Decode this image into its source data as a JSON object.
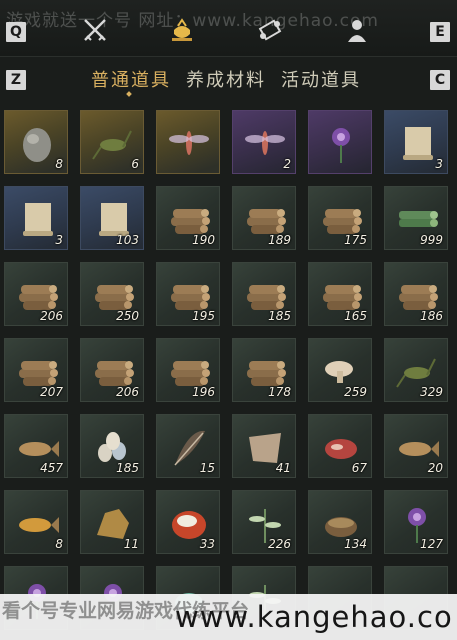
{
  "watermark_top": "游戏就送一个号  网址：www.kangehao.com",
  "keys": {
    "q": "Q",
    "e": "E",
    "z": "Z",
    "c": "C"
  },
  "top_icons": [
    "crossed-swords-icon",
    "cauldron-icon",
    "scroll-icon",
    "character-icon"
  ],
  "tabs": [
    {
      "label": "普通道具",
      "active": true
    },
    {
      "label": "养成材料",
      "active": false
    },
    {
      "label": "活动道具",
      "active": false
    }
  ],
  "items": [
    {
      "name": "stone-item",
      "count": "8",
      "rarity": "gold"
    },
    {
      "name": "cricket-item",
      "count": "6",
      "rarity": "gold"
    },
    {
      "name": "firefly-item",
      "count": "",
      "rarity": "gold"
    },
    {
      "name": "dragonfly-item",
      "count": "2",
      "rarity": "purple"
    },
    {
      "name": "purple-flower-item",
      "count": "",
      "rarity": "purple"
    },
    {
      "name": "scroll-item",
      "count": "3",
      "rarity": "blue"
    },
    {
      "name": "scroll-item",
      "count": "3",
      "rarity": "blue"
    },
    {
      "name": "scroll-item",
      "count": "103",
      "rarity": "blue"
    },
    {
      "name": "log-bundle-item",
      "count": "190",
      "rarity": "green"
    },
    {
      "name": "log-bundle-item",
      "count": "189",
      "rarity": "green"
    },
    {
      "name": "log-bundle-item",
      "count": "175",
      "rarity": "green"
    },
    {
      "name": "bamboo-bundle-item",
      "count": "999",
      "rarity": "green"
    },
    {
      "name": "log-bundle-item",
      "count": "206",
      "rarity": "green"
    },
    {
      "name": "log-bundle-item",
      "count": "250",
      "rarity": "green"
    },
    {
      "name": "log-bundle-item",
      "count": "195",
      "rarity": "green"
    },
    {
      "name": "log-bundle-item",
      "count": "185",
      "rarity": "green"
    },
    {
      "name": "log-bundle-item",
      "count": "165",
      "rarity": "green"
    },
    {
      "name": "log-bundle-item",
      "count": "186",
      "rarity": "green"
    },
    {
      "name": "log-bundle-item",
      "count": "207",
      "rarity": "green"
    },
    {
      "name": "log-bundle-item",
      "count": "206",
      "rarity": "green"
    },
    {
      "name": "log-bundle-item",
      "count": "196",
      "rarity": "green"
    },
    {
      "name": "log-bundle-item",
      "count": "178",
      "rarity": "green"
    },
    {
      "name": "mushroom-item",
      "count": "259",
      "rarity": "green"
    },
    {
      "name": "locust-item",
      "count": "329",
      "rarity": "green"
    },
    {
      "name": "fish-item",
      "count": "457",
      "rarity": "green"
    },
    {
      "name": "eggs-item",
      "count": "185",
      "rarity": "green"
    },
    {
      "name": "feathers-item",
      "count": "15",
      "rarity": "green"
    },
    {
      "name": "hide-item",
      "count": "41",
      "rarity": "green"
    },
    {
      "name": "meat-item",
      "count": "67",
      "rarity": "green"
    },
    {
      "name": "carp-item",
      "count": "20",
      "rarity": "green"
    },
    {
      "name": "goldfish-item",
      "count": "8",
      "rarity": "green"
    },
    {
      "name": "ore-item",
      "count": "11",
      "rarity": "green"
    },
    {
      "name": "amber-item",
      "count": "33",
      "rarity": "green"
    },
    {
      "name": "herb-item",
      "count": "226",
      "rarity": "green"
    },
    {
      "name": "mortar-item",
      "count": "134",
      "rarity": "green"
    },
    {
      "name": "purple-flower-item",
      "count": "127",
      "rarity": "green"
    },
    {
      "name": "lavender-item",
      "count": "",
      "rarity": "green"
    },
    {
      "name": "lavender-item",
      "count": "",
      "rarity": "green"
    },
    {
      "name": "jade-item",
      "count": "",
      "rarity": "green"
    },
    {
      "name": "herb-item",
      "count": "",
      "rarity": "green"
    },
    {
      "name": "blank-item",
      "count": "",
      "rarity": "green"
    },
    {
      "name": "blank-item",
      "count": "",
      "rarity": "green"
    }
  ],
  "bottom_banner": {
    "left_text": "看个号专业网易游戏代练平台",
    "url": "www.kangehao.co"
  }
}
